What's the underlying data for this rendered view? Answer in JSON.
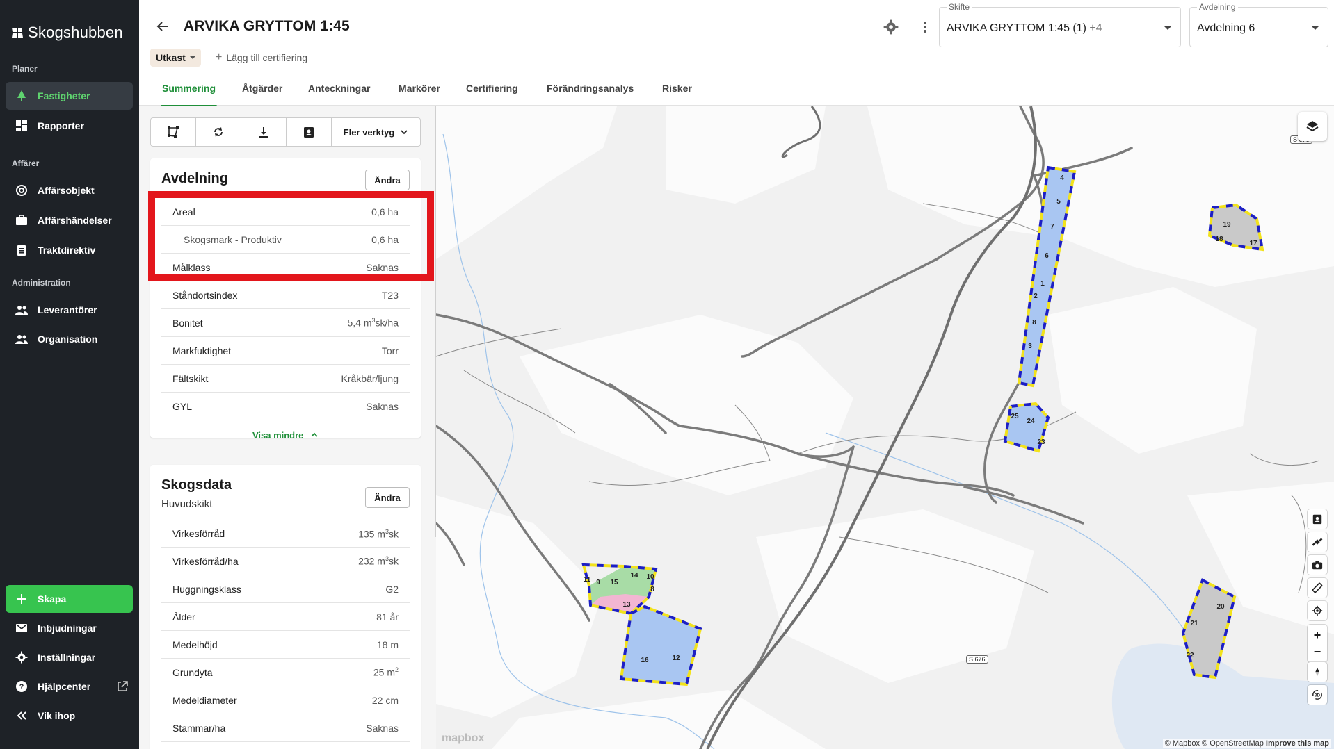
{
  "app": {
    "name": "Skogshubben"
  },
  "sidebar": {
    "sections": {
      "planer": "Planer",
      "affarer": "Affärer",
      "admin": "Administration"
    },
    "items": {
      "fastigheter": "Fastigheter",
      "rapporter": "Rapporter",
      "affarsobjekt": "Affärsobjekt",
      "affarshandelser": "Affärshändelser",
      "traktdirektiv": "Traktdirektiv",
      "leverantorer": "Leverantörer",
      "organisation": "Organisation",
      "skapa": "Skapa",
      "inbjudningar": "Inbjudningar",
      "installningar": "Inställningar",
      "hjalpcenter": "Hjälpcenter",
      "vik_ihop": "Vik ihop"
    }
  },
  "header": {
    "title": "ARVIKA GRYTTOM 1:45",
    "status": "Utkast",
    "add_cert": "Lägg till certifiering",
    "skifte": {
      "label": "Skifte",
      "value": "ARVIKA GRYTTOM 1:45 (1)",
      "extra": "+4"
    },
    "avdelning": {
      "label": "Avdelning",
      "value": "Avdelning 6"
    }
  },
  "tabs": [
    "Summering",
    "Åtgärder",
    "Anteckningar",
    "Markörer",
    "Certifiering",
    "Förändringsanalys",
    "Risker"
  ],
  "toolbar": {
    "more": "Fler verktyg"
  },
  "avdelning_card": {
    "title": "Avdelning",
    "edit": "Ändra",
    "rows": [
      {
        "k": "Areal",
        "v": "0,6 ha"
      },
      {
        "k": "Skogsmark - Produktiv",
        "v": "0,6 ha"
      },
      {
        "k": "Målklass",
        "v": "Saknas"
      },
      {
        "k": "Ståndortsindex",
        "v": "T23"
      },
      {
        "k": "Bonitet",
        "v": "5,4 m",
        "sup": "3",
        "suffix": "sk/ha"
      },
      {
        "k": "Markfuktighet",
        "v": "Torr"
      },
      {
        "k": "Fältskikt",
        "v": "Kråkbär/ljung"
      },
      {
        "k": "GYL",
        "v": "Saknas"
      }
    ],
    "show_less": "Visa mindre"
  },
  "skogsdata_card": {
    "title": "Skogsdata",
    "subtitle": "Huvudskikt",
    "edit": "Ändra",
    "rows": [
      {
        "k": "Virkesförråd",
        "v": "135 m",
        "sup": "3",
        "suffix": "sk"
      },
      {
        "k": "Virkesförråd/ha",
        "v": "232 m",
        "sup": "3",
        "suffix": "sk"
      },
      {
        "k": "Huggningsklass",
        "v": "G2"
      },
      {
        "k": "Ålder",
        "v": "81 år"
      },
      {
        "k": "Medelhöjd",
        "v": "18 m"
      },
      {
        "k": "Grundyta",
        "v": "25 m",
        "sup": "2",
        "suffix": ""
      },
      {
        "k": "Medeldiameter",
        "v": "22 cm"
      },
      {
        "k": "Stammar/ha",
        "v": "Saknas"
      }
    ]
  },
  "map": {
    "road_labels": [
      "S 676",
      "S 676"
    ],
    "parcel_labels": [
      "4",
      "5",
      "7",
      "6",
      "1",
      "2",
      "8",
      "3",
      "25",
      "24",
      "23",
      "19",
      "18",
      "17",
      "11",
      "9",
      "15",
      "14",
      "10",
      "8",
      "13",
      "16",
      "12",
      "20",
      "21",
      "22"
    ],
    "attribution": "© Mapbox © OpenStreetMap",
    "improve": "Improve this map",
    "logo": "mapbox",
    "colors": {
      "border_blue": "#1d1fc4",
      "border_yellow": "#f2e21c",
      "green": "#a8dca6",
      "blue": "#a9c6f2",
      "pink": "#f2b6d2",
      "gray": "#c9c9c9"
    }
  }
}
